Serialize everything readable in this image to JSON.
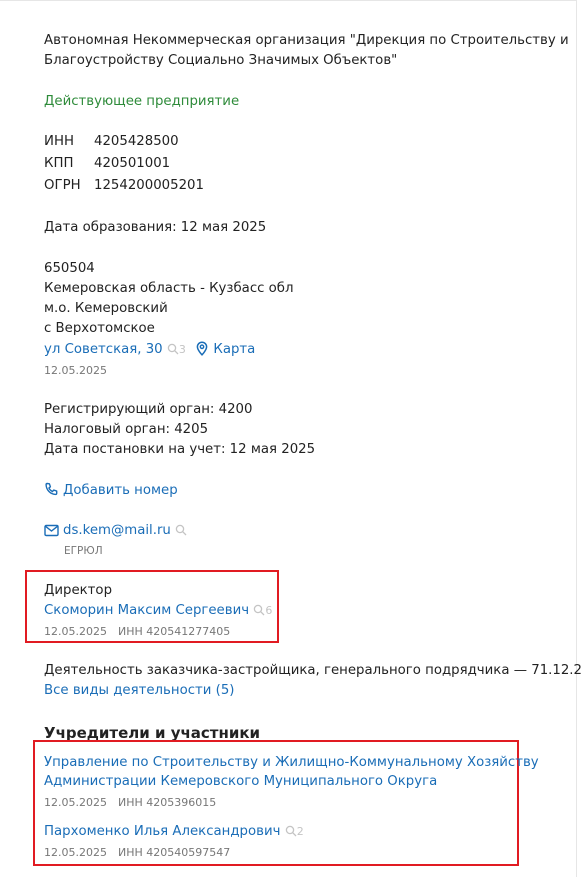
{
  "company": {
    "full_name_line1": "Автономная Некоммерческая организация \"Дирекция по Строительству и",
    "full_name_line2": "Благоустройству Социально Значимых Объектов\"",
    "status": "Действующее предприятие"
  },
  "codes": {
    "inn_label": "ИНН",
    "inn_value": "4205428500",
    "kpp_label": "КПП",
    "kpp_value": "420501001",
    "ogrn_label": "ОГРН",
    "ogrn_value": "1254200005201"
  },
  "founded": "Дата образования: 12 мая 2025",
  "address": {
    "zip": "650504",
    "region": "Кемеровская область - Кузбасс обл",
    "district": "м.о. Кемеровский",
    "settlement": "с Верхотомское",
    "street": "ул Советская, 30",
    "street_count": "3",
    "map_label": "Карта",
    "date": "12.05.2025"
  },
  "registration": {
    "reg_org": "Регистрирующий орган: 4200",
    "tax_org": "Налоговый орган: 4205",
    "registered": "Дата постановки на учет: 12 мая 2025"
  },
  "contacts": {
    "add_phone": "Добавить номер",
    "email": "ds.kem@mail.ru",
    "email_source": "ЕГРЮЛ"
  },
  "director": {
    "title": "Директор",
    "name": "Скоморин Максим Сергеевич",
    "count": "6",
    "date": "12.05.2025",
    "inn": "ИНН 420541277405"
  },
  "activity": {
    "main": "Деятельность заказчика-застройщика, генерального подрядчика — 71.12.2",
    "all_link": "Все виды деятельности (5)"
  },
  "founders": {
    "heading": "Учредители и участники",
    "items": [
      {
        "name_line1": "Управление по Строительству и Жилищно-Коммунальному Хозяйству",
        "name_line2": "Администрации Кемеровского Муниципального Округа",
        "date": "12.05.2025",
        "inn": "ИНН 4205396015"
      },
      {
        "name_line1": "Пархоменко Илья Александрович",
        "count": "2",
        "date": "12.05.2025",
        "inn": "ИНН 420540597547"
      }
    ]
  },
  "colors": {
    "link": "#1a6db7",
    "status_green": "#2e8b3a",
    "highlight_red": "#e11b22",
    "muted": "#777777"
  }
}
